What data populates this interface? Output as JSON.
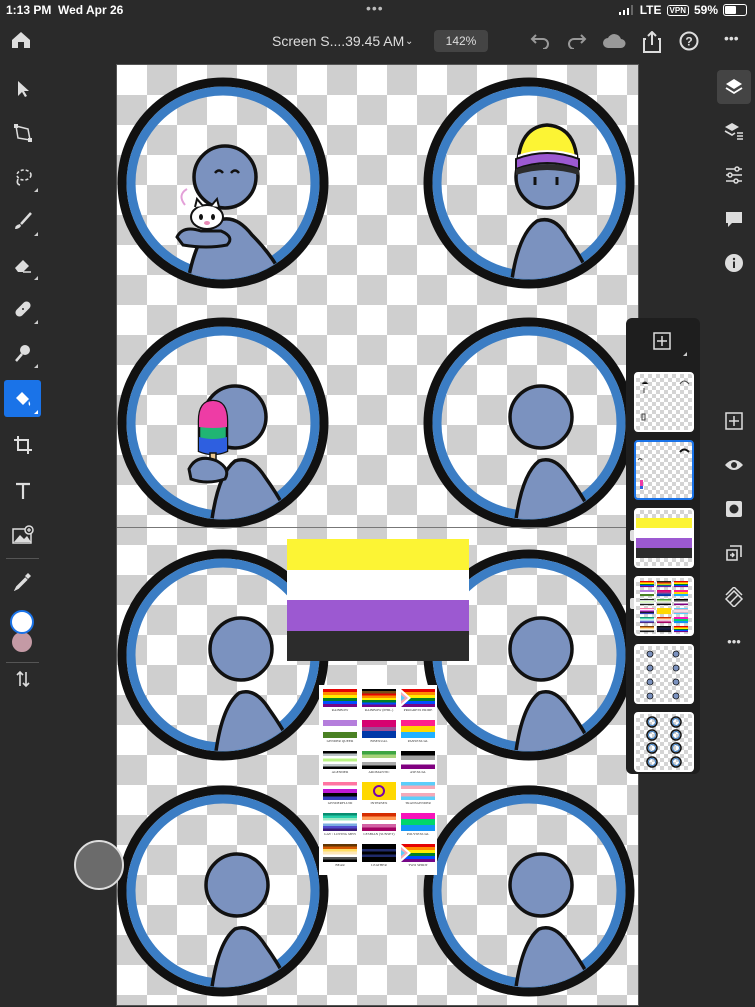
{
  "status_bar": {
    "time": "1:13 PM",
    "date": "Wed Apr 26",
    "network": "LTE",
    "vpn": "VPN",
    "battery": "59%",
    "battery_level": 0.59
  },
  "top_bar": {
    "document_title": "Screen S....39.45 AM",
    "zoom": "142%",
    "icons": [
      "home-icon",
      "undo-icon",
      "redo-icon",
      "cloud-icon",
      "share-icon",
      "help-icon",
      "more-icon"
    ]
  },
  "toolbar": {
    "tools": [
      "select-icon",
      "transform-icon",
      "lasso-icon",
      "brush-icon",
      "eraser-icon",
      "healing-icon",
      "smudge-icon",
      "fill-icon",
      "crop-icon",
      "type-icon",
      "place-image-icon",
      "eyedropper-icon"
    ],
    "active_tool": "fill-icon",
    "foreground_color": "#ffffff",
    "background_color": "#c49aa5"
  },
  "right_bar": {
    "icons": [
      "layers-icon",
      "layer-properties-icon",
      "adjustments-icon",
      "comments-icon",
      "info-icon",
      "add-layer-icon",
      "visibility-icon",
      "mask-icon",
      "arrange-icon",
      "clear-icon",
      "more-icon"
    ]
  },
  "layers_panel": {
    "layers": [
      {
        "name": "sketch-layer"
      },
      {
        "name": "details-layer",
        "selected": true
      },
      {
        "name": "nonbinary-flag-layer",
        "linked": true
      },
      {
        "name": "pride-flags-layer",
        "linked": true
      },
      {
        "name": "figures-layer"
      },
      {
        "name": "circles-layer"
      }
    ]
  },
  "canvas": {
    "colors": {
      "ring_blue": "#3b7dc4",
      "figure_blue": "#7b92bf",
      "outline": "#111111"
    },
    "nonbinary_flag": [
      "#fcf434",
      "#ffffff",
      "#9c59d1",
      "#2c2c2c"
    ],
    "pride_flags": [
      {
        "label": "RAINBOW"
      },
      {
        "label": "RAINBOW (PHIL.)"
      },
      {
        "label": "PROGRESS PRIDE"
      },
      {
        "label": "GENDER QUEER"
      },
      {
        "label": "BISEXUAL"
      },
      {
        "label": "PANSEXUAL"
      },
      {
        "label": "AGENDER"
      },
      {
        "label": "AROMANTIC"
      },
      {
        "label": "ASEXUAL"
      },
      {
        "label": "GENDERFLUID"
      },
      {
        "label": "INTERSEX"
      },
      {
        "label": "TRANSGENDER"
      },
      {
        "label": "GAY / LOVING MEN"
      },
      {
        "label": "LESBIAN (SUNSET)"
      },
      {
        "label": "POLYSEXUAL"
      },
      {
        "label": "BEAR"
      },
      {
        "label": "LEATHER"
      },
      {
        "label": "TWO SPIRIT"
      }
    ]
  }
}
